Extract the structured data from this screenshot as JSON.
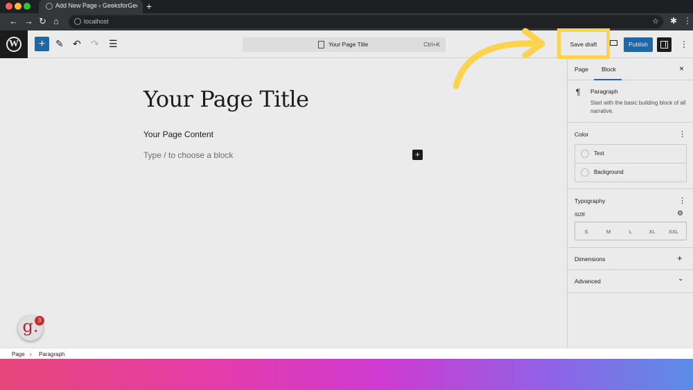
{
  "browser": {
    "tab_title": "Add New Page ‹ GeeksforGeeks —",
    "new_tab_symbol": "+",
    "url": "localhost",
    "nav": {
      "back": "←",
      "forward": "→",
      "reload": "↻",
      "home": "⌂"
    },
    "icons": [
      "globe-icon",
      "star-icon",
      "puzzle-icon",
      "kebab-icon"
    ]
  },
  "toolbar": {
    "logo_letter": "W",
    "add_symbol": "+",
    "tools": {
      "edit": "✎",
      "undo": "↶",
      "redo": "↷",
      "outline": "☰"
    },
    "command_title": "Your Page Title",
    "command_shortcut": "Ctrl+K",
    "save_draft_label": "Save draft",
    "publish_label": "Publish",
    "more_symbol": "⋮"
  },
  "editor": {
    "title": "Your Page Title",
    "content": "Your Page Content",
    "placeholder": "Type / to choose a block",
    "inline_add_symbol": "+"
  },
  "sidebar": {
    "tabs": [
      "Page",
      "Block"
    ],
    "active_tab": "Block",
    "close_symbol": "×",
    "block": {
      "icon": "¶",
      "name": "Paragraph",
      "description": "Start with the basic building block of all narrative."
    },
    "color": {
      "heading": "Color",
      "items": [
        "Text",
        "Background"
      ]
    },
    "typography": {
      "heading": "Typography",
      "size_label": "SIZE",
      "sizes": [
        "S",
        "M",
        "L",
        "XL",
        "XXL"
      ]
    },
    "dimensions": {
      "heading": "Dimensions",
      "symbol": "+"
    },
    "advanced": {
      "heading": "Advanced",
      "symbol": "⌄"
    }
  },
  "footer": {
    "breadcrumb": [
      "Page",
      "Paragraph"
    ],
    "separator": "›"
  },
  "badge": {
    "letter": "g.",
    "count": "3"
  },
  "colors": {
    "accent": "#2271b1",
    "highlight": "#fcd34d",
    "dark": "#1e1e1e"
  }
}
